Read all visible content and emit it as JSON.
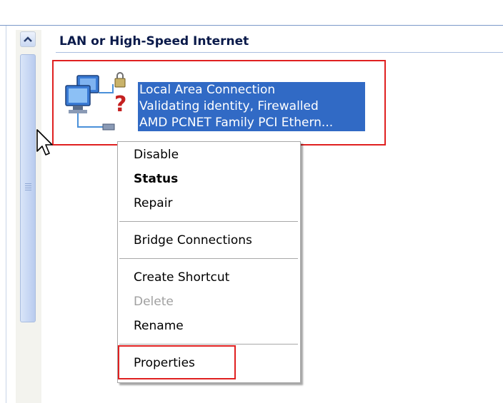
{
  "group": {
    "header": "LAN or High-Speed Internet"
  },
  "connection": {
    "name": "Local Area Connection",
    "status": "Validating identity, Firewalled",
    "device": "AMD PCNET Family PCI Ethern...",
    "icon": "network-connection-icon"
  },
  "context_menu": {
    "disable": "Disable",
    "status": "Status",
    "repair": "Repair",
    "bridge": "Bridge Connections",
    "create_shortcut": "Create Shortcut",
    "delete": "Delete",
    "rename": "Rename",
    "properties": "Properties"
  },
  "colors": {
    "selection": "#316ac5",
    "annotation": "#e02020",
    "disabled_text": "#a0a0a0"
  }
}
